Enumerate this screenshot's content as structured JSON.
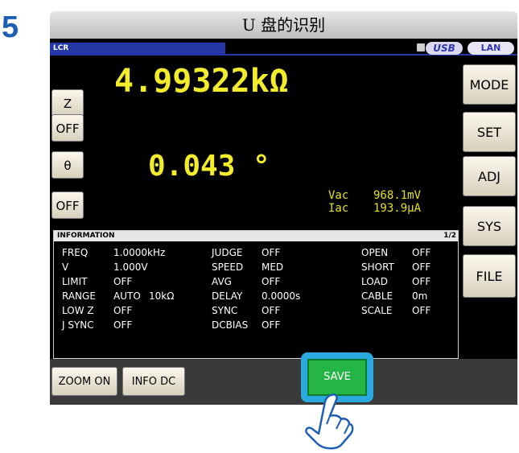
{
  "step_number": "5",
  "title": "U 盘的识别",
  "mode_label": "LCR",
  "status": {
    "usb_label": "USB",
    "lan_label": "LAN"
  },
  "params": [
    {
      "button": "Z",
      "value": "4.99322kΩ"
    },
    {
      "button": "OFF"
    },
    {
      "button": "θ",
      "value": "0.043 °"
    },
    {
      "button": "OFF"
    }
  ],
  "monitor": {
    "vac_label": "Vac",
    "vac_value": "968.1mV",
    "iac_label": "Iac",
    "iac_value": "193.9μA"
  },
  "right_menu": [
    "MODE",
    "SET",
    "ADJ",
    "SYS",
    "FILE"
  ],
  "info": {
    "header": "INFORMATION",
    "page": "1/2",
    "rows": [
      [
        "FREQ",
        "1.0000kHz",
        "",
        "JUDGE",
        "OFF",
        "OPEN",
        "OFF"
      ],
      [
        "V",
        "1.000V",
        "",
        "SPEED",
        "MED",
        "SHORT",
        "OFF"
      ],
      [
        "LIMIT",
        "OFF",
        "",
        "AVG",
        "OFF",
        "LOAD",
        "OFF"
      ],
      [
        "RANGE",
        "AUTO",
        "10kΩ",
        "DELAY",
        "0.0000s",
        "CABLE",
        "0m"
      ],
      [
        "LOW Z",
        "OFF",
        "",
        "SYNC",
        "OFF",
        "SCALE",
        "OFF"
      ],
      [
        "J SYNC",
        "OFF",
        "",
        "DCBIAS",
        "OFF",
        "",
        ""
      ]
    ]
  },
  "bottom": {
    "zoom_label": "ZOOM ON",
    "info_label": "INFO DC",
    "save_label": "SAVE"
  },
  "colors": {
    "accent": "#2536a6",
    "value_yellow": "#f2ec2a",
    "save_green": "#25b546",
    "highlight_blue": "#2aa9de",
    "step_blue": "#1e5fb4"
  }
}
